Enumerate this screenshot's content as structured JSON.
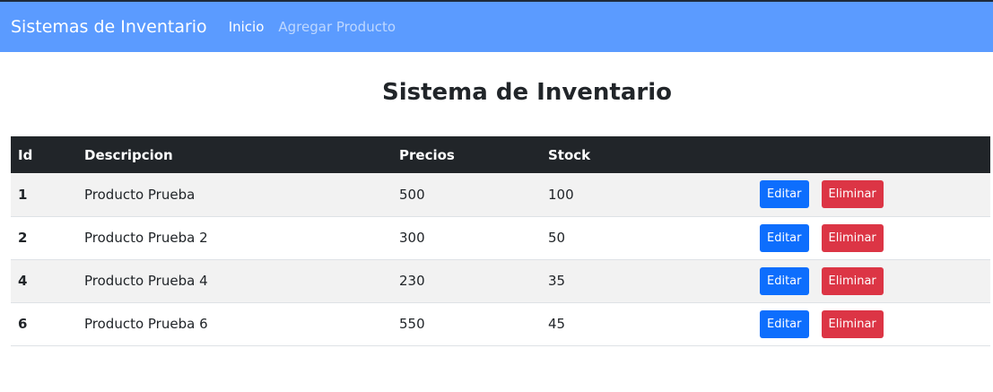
{
  "navbar": {
    "brand": "Sistemas de Inventario",
    "links": [
      {
        "label": "Inicio"
      },
      {
        "label": "Agregar Producto"
      }
    ]
  },
  "page_title": "Sistema de Inventario",
  "table": {
    "headers": [
      "Id",
      "Descripcion",
      "Precios",
      "Stock",
      ""
    ],
    "rows": [
      {
        "id": "1",
        "descripcion": "Producto Prueba",
        "precio": "500",
        "stock": "100"
      },
      {
        "id": "2",
        "descripcion": "Producto Prueba 2",
        "precio": "300",
        "stock": "50"
      },
      {
        "id": "4",
        "descripcion": "Producto Prueba 4",
        "precio": "230",
        "stock": "35"
      },
      {
        "id": "6",
        "descripcion": "Producto Prueba 6",
        "precio": "550",
        "stock": "45"
      }
    ],
    "actions": {
      "edit_label": "Editar",
      "delete_label": "Eliminar"
    }
  },
  "colors": {
    "navbar_bg": "#5b9bff",
    "table_header_bg": "#212529",
    "edit_button": "#0d6efd",
    "delete_button": "#dc3545"
  }
}
